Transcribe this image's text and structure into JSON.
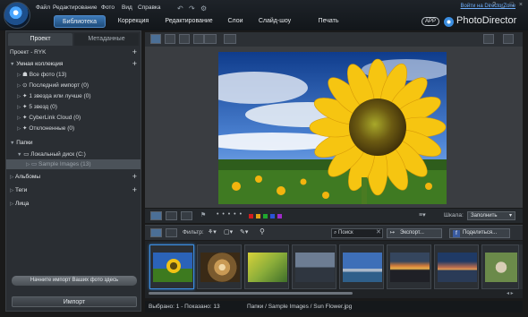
{
  "menu": [
    "Файл",
    "Редактирование",
    "Фото",
    "Вид",
    "Справка"
  ],
  "top_link": "Войти на DirectorZone",
  "window_controls": "? _ □ ×",
  "main_tabs": [
    {
      "label": "Библиотека",
      "active": true
    },
    {
      "label": "Коррекция"
    },
    {
      "label": "Редактирование"
    },
    {
      "label": "Слои"
    },
    {
      "label": "Слайд-шоу"
    },
    {
      "label": "Печать"
    }
  ],
  "app_badge": "APP",
  "brand": "PhotoDirector",
  "left": {
    "tabs": [
      "Проект",
      "Метаданные"
    ],
    "project": "Проект - RYK",
    "smart_collection": "Умная коллекция",
    "smart_items": [
      "Все фото (13)",
      "Последний импорт (0)",
      "1 звезда или лучше (0)",
      "5 звезд (0)",
      "CyberLink Cloud (0)",
      "Отклоненные (0)"
    ],
    "folders": "Папки",
    "local_disk": "Локальный диск (C:)",
    "sample_folder": "Sample Images (13)",
    "albums": "Альбомы",
    "tags": "Теги",
    "faces": "Лица",
    "import_hint": "Начните импорт Ваших фото здесь",
    "import_button": "Импорт"
  },
  "controls": {
    "stars": "• • • • •",
    "scale_label": "Шкала:",
    "scale_value": "Заполнить",
    "filter_label": "Фильтр:",
    "search_value": "Поиск",
    "export_button": "Экспорт...",
    "share_button": "Поделиться..."
  },
  "colors": {
    "swatches": [
      "#d11d1d",
      "#e0a214",
      "#1fa82e",
      "#2a54d6",
      "#a02ac9"
    ]
  },
  "status": {
    "selected": "Выбрано: 1 - Показано: 13",
    "path": "Папки / Sample Images / Sun Flower.jpg"
  }
}
